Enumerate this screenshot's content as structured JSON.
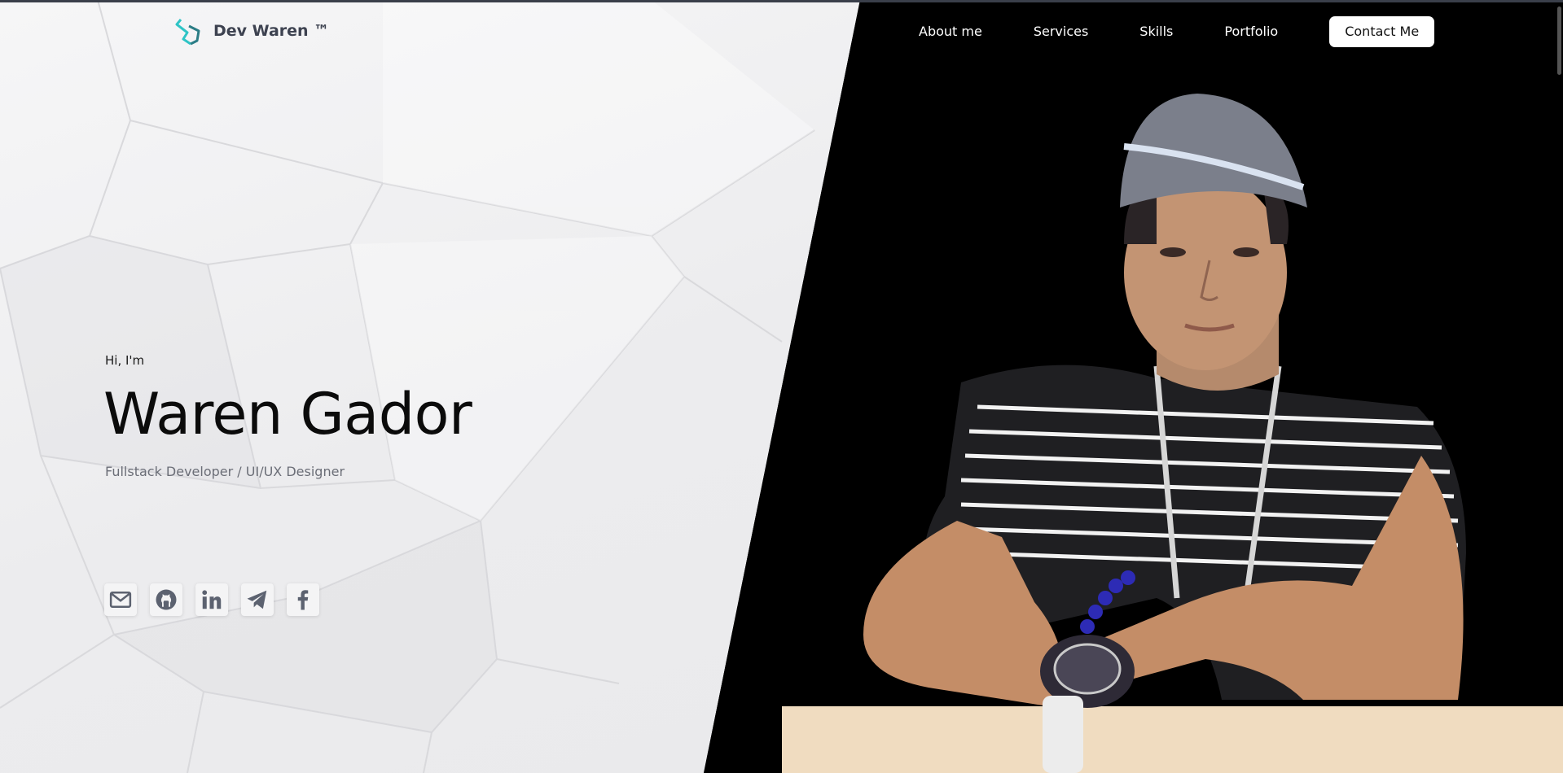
{
  "brand": {
    "name": "Dev Waren ™",
    "accent": "#2ec4c6"
  },
  "nav": {
    "items": [
      "About me",
      "Services",
      "Skills",
      "Portfolio"
    ],
    "contact": "Contact Me"
  },
  "hero": {
    "greeting": "Hi, I'm",
    "name": "Waren Gador",
    "role": "Fullstack Developer / UI/UX Designer"
  },
  "socials": [
    {
      "icon": "mail-icon"
    },
    {
      "icon": "github-icon"
    },
    {
      "icon": "linkedin-icon"
    },
    {
      "icon": "telegram-icon"
    },
    {
      "icon": "facebook-icon"
    }
  ],
  "colors": {
    "left_bg": "#ececee",
    "right_bg": "#000000",
    "text_dark": "#0b0b0b",
    "text_muted": "#6b6e77",
    "icon_gray": "#5c6270"
  }
}
